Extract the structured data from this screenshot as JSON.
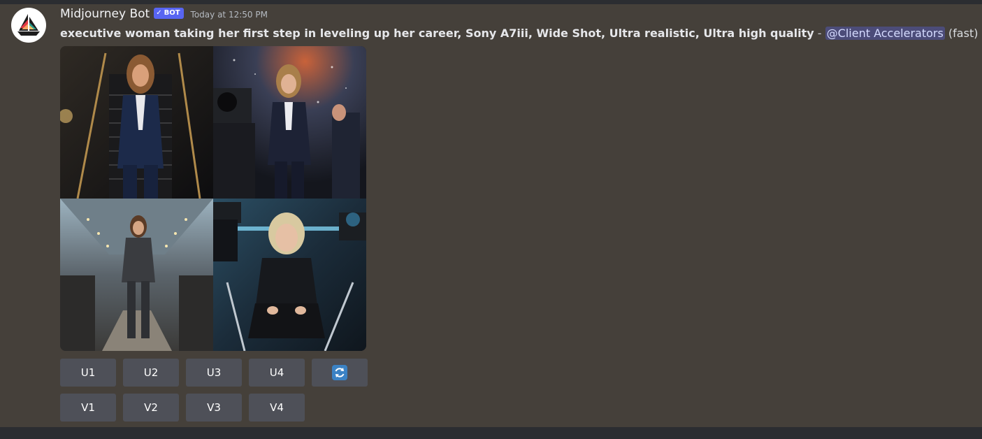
{
  "message": {
    "author": "Midjourney Bot",
    "badge": "BOT",
    "badge_check": "✓",
    "timestamp": "Today at 12:50 PM",
    "prompt": "executive woman taking her first step in leveling up her career, Sony A7iii, Wide Shot, Ultra realistic, Ultra high quality",
    "separator": " - ",
    "mention": "@Client Accelerators",
    "mode": "(fast)"
  },
  "avatar": {
    "icon": "sailboat-icon"
  },
  "image_grid": {
    "tiles": [
      {
        "icon": "image-icon"
      },
      {
        "icon": "image-icon"
      },
      {
        "icon": "image-icon"
      },
      {
        "icon": "image-icon"
      }
    ]
  },
  "buttons": {
    "upscale": [
      "U1",
      "U2",
      "U3",
      "U4"
    ],
    "variation": [
      "V1",
      "V2",
      "V3",
      "V4"
    ],
    "reroll_icon": "refresh-icon"
  },
  "colors": {
    "background": "#45403a",
    "button": "#4e5058",
    "badge": "#5865f2",
    "mention_bg": "#5865f259",
    "refresh": "#3b82c4"
  }
}
